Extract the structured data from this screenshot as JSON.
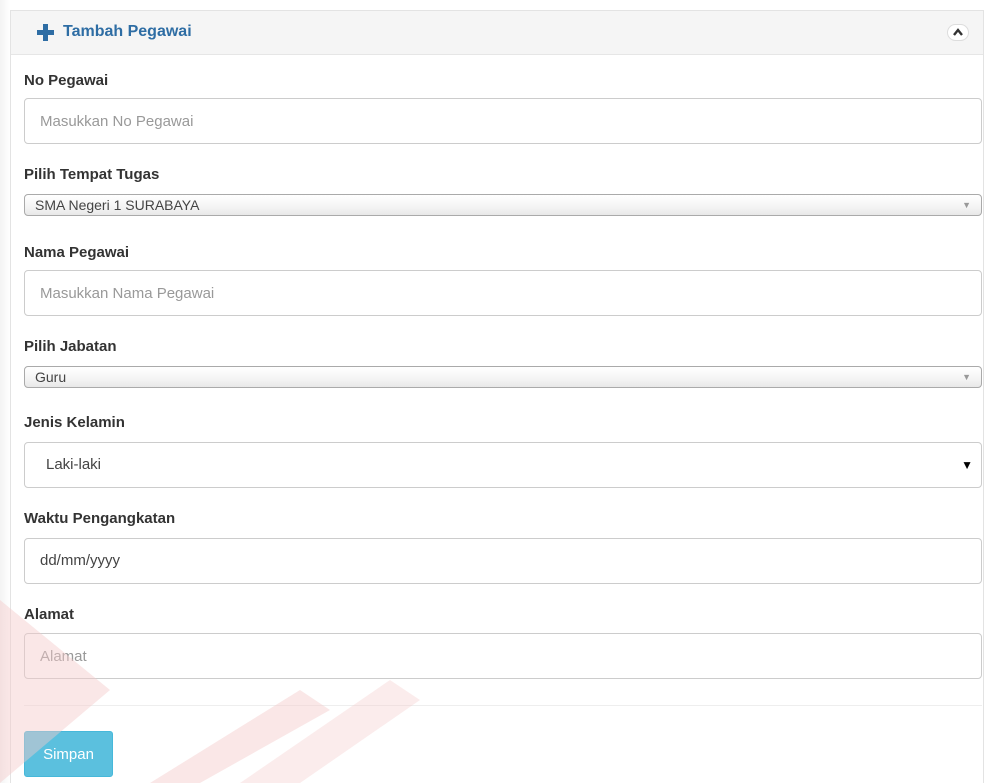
{
  "panel": {
    "title": "Tambah Pegawai",
    "icons": {
      "add": "plus-icon",
      "collapse": "chevron-up-icon"
    },
    "accent_color": "#2e6da4"
  },
  "form": {
    "no_pegawai": {
      "label": "No Pegawai",
      "placeholder": "Masukkan No Pegawai"
    },
    "tempat_tugas": {
      "label": "Pilih Tempat Tugas",
      "selected": "SMA Negeri 1 SURABAYA"
    },
    "nama_pegawai": {
      "label": "Nama Pegawai",
      "placeholder": "Masukkan Nama Pegawai"
    },
    "jabatan": {
      "label": "Pilih Jabatan",
      "selected": "Guru"
    },
    "jenis_kelamin": {
      "label": "Jenis Kelamin",
      "selected": "Laki-laki"
    },
    "waktu_pengangkatan": {
      "label": "Waktu Pengangkatan",
      "value": "dd/mm/yyyy"
    },
    "alamat": {
      "label": "Alamat",
      "placeholder": "Alamat"
    }
  },
  "actions": {
    "save_label": "Simpan",
    "save_color": "#5bc0de"
  }
}
